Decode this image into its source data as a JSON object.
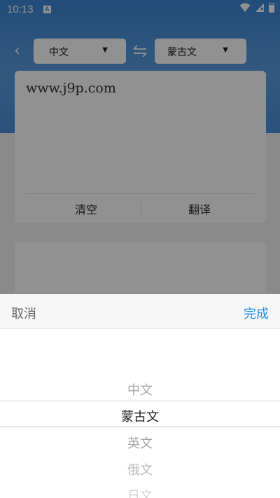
{
  "status_bar": {
    "time": "10:13",
    "notification_badge": "A"
  },
  "header": {
    "source_language": "中文",
    "target_language": "蒙古文"
  },
  "input_card": {
    "text": "www.j9p.com",
    "clear_label": "清空",
    "translate_label": "翻译"
  },
  "picker_sheet": {
    "cancel_label": "取消",
    "done_label": "完成",
    "options": [
      "中文",
      "蒙古文",
      "英文",
      "俄文",
      "日文"
    ],
    "selected": "蒙古文"
  },
  "colors": {
    "accent": "#1e8ff0",
    "header_blue": "#3c87d6"
  }
}
